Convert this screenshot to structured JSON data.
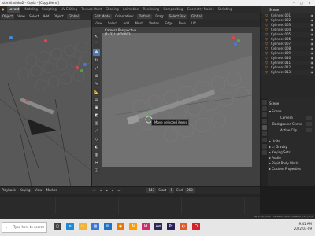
{
  "window": {
    "title": "stemitvdoka2 - Copia - [Copy.blend]"
  },
  "menubar": {
    "tabs": [
      "Layout",
      "Modeling",
      "Sculpting",
      "UV Editing",
      "Texture Paint",
      "Shading",
      "Animation",
      "Rendering",
      "Compositing",
      "Geometry Nodes",
      "Scripting"
    ],
    "active_tab": "Layout",
    "scene_label": "Scene"
  },
  "left_view": {
    "mode": "Object",
    "view_items": [
      "View",
      "Select",
      "Add",
      "Object"
    ],
    "transform": "Global"
  },
  "right_view": {
    "mode": "Edit Mode",
    "orientation_label": "Orientation:",
    "orientation": "Default",
    "drag_label": "Drag:",
    "drag_value": "Select Box",
    "transform": "Global",
    "menu_items": [
      "View",
      "Select",
      "Add",
      "Mesh",
      "Vertex",
      "Edge",
      "Face",
      "UV"
    ],
    "overlay_title": "Camera Perspective",
    "overlay_sub": "(143) l.abOl.003",
    "tooltip": "Move selected items."
  },
  "outliner": {
    "title": "Scene",
    "items": [
      "Cylinder.001",
      "Cylinder.002",
      "Cylinder.003",
      "Cylinder.004",
      "Cylinder.005",
      "Cylinder.006",
      "Cylinder.007",
      "Cylinder.008",
      "Cylinder.009",
      "Cylinder.010",
      "Cylinder.011",
      "Cylinder.012",
      "Cylinder.013"
    ]
  },
  "properties": {
    "breadcrumb": "Scene",
    "section_scene": "Scene",
    "camera_label": "Camera",
    "background_label": "Background Scene",
    "active_clip_label": "Active Clip",
    "sections": [
      "Units",
      "Gravity",
      "Keying Sets",
      "Audio",
      "Rigid Body World",
      "Custom Properties"
    ]
  },
  "timeline": {
    "playback": "Playback",
    "keying": "Keying",
    "view": "View",
    "marker": "Marker",
    "current_frame": "143",
    "start_label": "Start",
    "start_value": "1",
    "end_label": "End",
    "end_value": "250"
  },
  "statusbar": {
    "text": "Verts 20/3,072 | Faces 0/1,984 | Objects 1/13 | 3.x"
  },
  "taskbar": {
    "search_placeholder": "Type here to search",
    "time": "9:41 AM",
    "date": "2022-03-09",
    "apps": [
      {
        "name": "task-view-icon",
        "color": "#444444"
      },
      {
        "name": "edge-icon",
        "color": "#1e8ad6"
      },
      {
        "name": "file-explorer-icon",
        "color": "#f2b33d"
      },
      {
        "name": "store-icon",
        "color": "#3b78d6"
      },
      {
        "name": "mail-icon",
        "color": "#1a73c9"
      },
      {
        "name": "blender-icon",
        "color": "#ea7600"
      },
      {
        "name": "illustrator-icon",
        "color": "#ff9a00"
      },
      {
        "name": "indesign-icon",
        "color": "#cc2c6d"
      },
      {
        "name": "after-effects-icon",
        "color": "#2d2658"
      },
      {
        "name": "premiere-icon",
        "color": "#2b1f58"
      },
      {
        "name": "firefox-icon",
        "color": "#e35b2b"
      },
      {
        "name": "opera-icon",
        "color": "#d3222a"
      }
    ]
  }
}
